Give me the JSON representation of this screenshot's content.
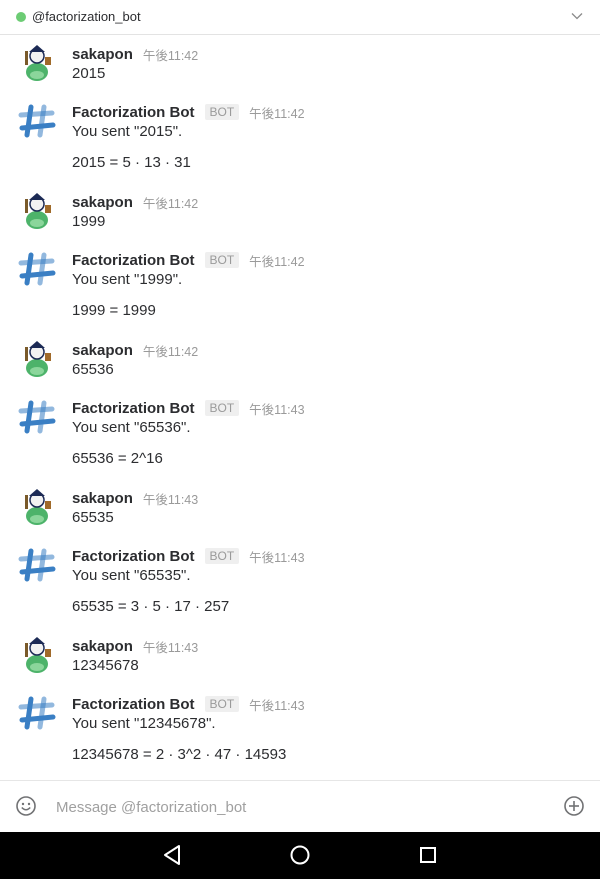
{
  "header": {
    "channel": "@factorization_bot",
    "status_color": "#6ccc74"
  },
  "messages": [
    {
      "author": "sakapon",
      "time": "午後11:42",
      "lines": [
        "2015"
      ],
      "avatar": "user-avatar"
    },
    {
      "author": "Factorization Bot",
      "badge": "BOT",
      "time": "午後11:42",
      "lines": [
        "You sent \"2015\".",
        "2015 = 5 · 13 · 31"
      ],
      "avatar": "bot-avatar"
    },
    {
      "author": "sakapon",
      "time": "午後11:42",
      "lines": [
        "1999"
      ],
      "avatar": "user-avatar"
    },
    {
      "author": "Factorization Bot",
      "badge": "BOT",
      "time": "午後11:42",
      "lines": [
        "You sent \"1999\".",
        "1999 = 1999"
      ],
      "avatar": "bot-avatar"
    },
    {
      "author": "sakapon",
      "time": "午後11:42",
      "lines": [
        "65536"
      ],
      "avatar": "user-avatar"
    },
    {
      "author": "Factorization Bot",
      "badge": "BOT",
      "time": "午後11:43",
      "lines": [
        "You sent \"65536\".",
        "65536 = 2^16"
      ],
      "avatar": "bot-avatar"
    },
    {
      "author": "sakapon",
      "time": "午後11:43",
      "lines": [
        "65535"
      ],
      "avatar": "user-avatar"
    },
    {
      "author": "Factorization Bot",
      "badge": "BOT",
      "time": "午後11:43",
      "lines": [
        "You sent \"65535\".",
        "65535 = 3 · 5 · 17 · 257"
      ],
      "avatar": "bot-avatar"
    },
    {
      "author": "sakapon",
      "time": "午後11:43",
      "lines": [
        "12345678"
      ],
      "avatar": "user-avatar"
    },
    {
      "author": "Factorization Bot",
      "badge": "BOT",
      "time": "午後11:43",
      "lines": [
        "You sent \"12345678\".",
        "12345678 = 2 · 3^2 · 47 · 14593"
      ],
      "avatar": "bot-avatar"
    }
  ],
  "composer": {
    "placeholder": "Message @factorization_bot",
    "value": ""
  },
  "icons": {
    "emoji": "smiley-icon",
    "attach": "plus-circle-icon",
    "nav": [
      "back-icon",
      "home-icon",
      "recents-icon"
    ]
  }
}
